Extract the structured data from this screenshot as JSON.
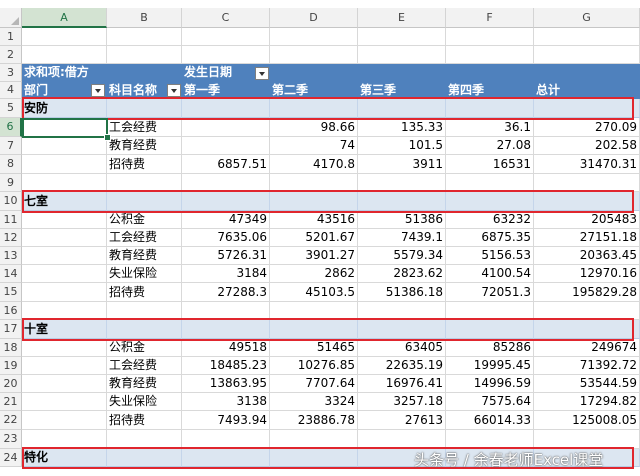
{
  "columns": [
    "A",
    "B",
    "C",
    "D",
    "E",
    "F",
    "G"
  ],
  "row_numbers": [
    "1",
    "2",
    "3",
    "4",
    "5",
    "6",
    "7",
    "8",
    "9",
    "10",
    "11",
    "12",
    "13",
    "14",
    "15",
    "16",
    "17",
    "18",
    "19",
    "20",
    "21",
    "22",
    "23",
    "24"
  ],
  "pivot": {
    "row3_label": "求和项:借方",
    "row3_date_field": "发生日期",
    "header": [
      "部门",
      "科目名称",
      "第一季",
      "第二季",
      "第三季",
      "第四季",
      "总计"
    ]
  },
  "groups": [
    {
      "name": "安防",
      "rows": [
        {
          "item": "工会经费",
          "q1": "",
          "q2": "98.66",
          "q3": "135.33",
          "q4": "36.1",
          "total": "270.09"
        },
        {
          "item": "教育经费",
          "q1": "",
          "q2": "74",
          "q3": "101.5",
          "q4": "27.08",
          "total": "202.58"
        },
        {
          "item": "招待费",
          "q1": "6857.51",
          "q2": "4170.8",
          "q3": "3911",
          "q4": "16531",
          "total": "31470.31"
        }
      ]
    },
    {
      "name": "七室",
      "rows": [
        {
          "item": "公积金",
          "q1": "47349",
          "q2": "43516",
          "q3": "51386",
          "q4": "63232",
          "total": "205483"
        },
        {
          "item": "工会经费",
          "q1": "7635.06",
          "q2": "5201.67",
          "q3": "7439.1",
          "q4": "6875.35",
          "total": "27151.18"
        },
        {
          "item": "教育经费",
          "q1": "5726.31",
          "q2": "3901.27",
          "q3": "5579.34",
          "q4": "5156.53",
          "total": "20363.45"
        },
        {
          "item": "失业保险",
          "q1": "3184",
          "q2": "2862",
          "q3": "2823.62",
          "q4": "4100.54",
          "total": "12970.16"
        },
        {
          "item": "招待费",
          "q1": "27288.3",
          "q2": "45103.5",
          "q3": "51386.18",
          "q4": "72051.3",
          "total": "195829.28"
        }
      ]
    },
    {
      "name": "十室",
      "rows": [
        {
          "item": "公积金",
          "q1": "49518",
          "q2": "51465",
          "q3": "63405",
          "q4": "85286",
          "total": "249674"
        },
        {
          "item": "工会经费",
          "q1": "18485.23",
          "q2": "10276.85",
          "q3": "22635.19",
          "q4": "19995.45",
          "total": "71392.72"
        },
        {
          "item": "教育经费",
          "q1": "13863.95",
          "q2": "7707.64",
          "q3": "16976.41",
          "q4": "14996.59",
          "total": "53544.59"
        },
        {
          "item": "失业保险",
          "q1": "3138",
          "q2": "3324",
          "q3": "3257.18",
          "q4": "7575.64",
          "total": "17294.82"
        },
        {
          "item": "招待费",
          "q1": "7493.94",
          "q2": "23886.78",
          "q3": "27613",
          "q4": "66014.33",
          "total": "125008.05"
        }
      ]
    },
    {
      "name": "特化",
      "rows": []
    }
  ],
  "watermark": "头条号 / 余春老师Excel课堂",
  "colors": {
    "header_band": "#4f81bd",
    "group_band": "#dce6f1",
    "highlight_box": "#e0262e",
    "selection": "#217346"
  }
}
